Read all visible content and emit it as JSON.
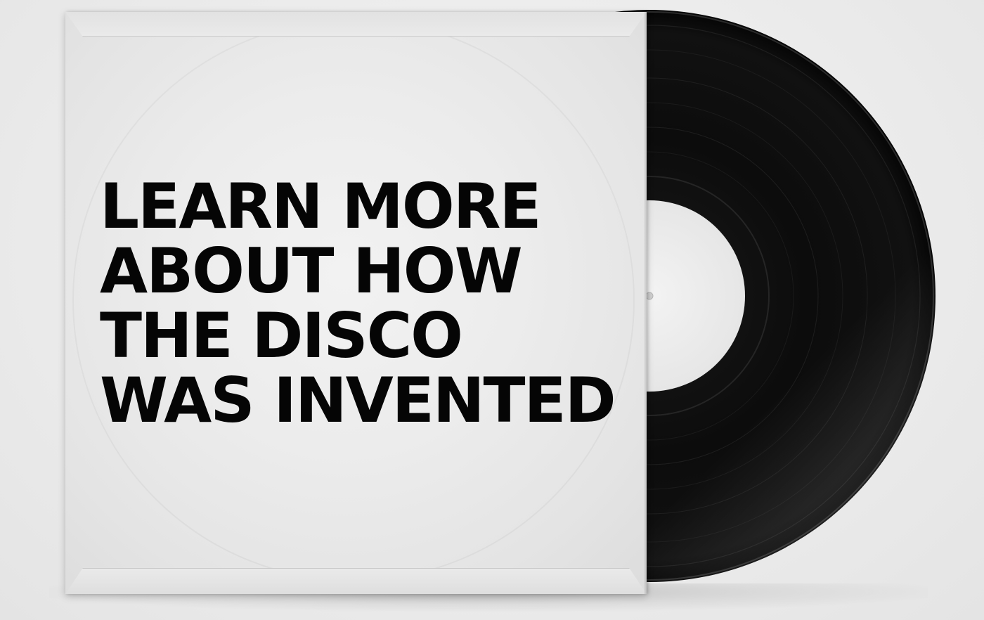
{
  "headline": {
    "lines": [
      "LEARN MORE",
      "ABOUT HOW",
      "THE DISCO",
      "WAS INVENTED"
    ]
  },
  "colors": {
    "background": "#ececec",
    "sleeve": "#ececec",
    "record": "#0b0b0b",
    "label": "#efefef",
    "text": "#050505"
  },
  "icons": {
    "record": "vinyl-record-icon"
  }
}
